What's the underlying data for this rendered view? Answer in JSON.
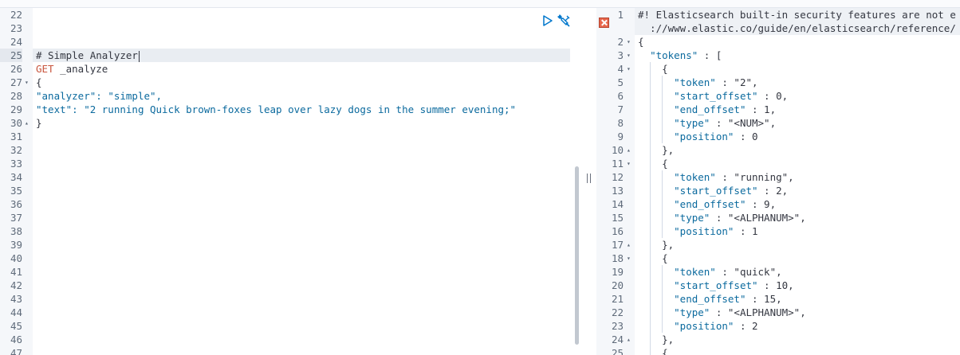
{
  "left_editor": {
    "lines": [
      {
        "n": "22",
        "fold": "",
        "text": ""
      },
      {
        "n": "23",
        "fold": "",
        "text": ""
      },
      {
        "n": "24",
        "fold": "",
        "text": ""
      },
      {
        "n": "25",
        "fold": "",
        "text": "# Simple Analyzer",
        "kind": "comment",
        "active": true
      },
      {
        "n": "26",
        "fold": "",
        "method": "GET",
        "text": " _analyze",
        "kind": "request"
      },
      {
        "n": "27",
        "fold": "▾",
        "text": "{"
      },
      {
        "n": "28",
        "fold": "",
        "key": "\"analyzer\"",
        "text": ": \"simple\","
      },
      {
        "n": "29",
        "fold": "",
        "key": "\"text\"",
        "text": ": \"2 running Quick brown-foxes leap over lazy dogs in the summer evening;\""
      },
      {
        "n": "30",
        "fold": "▴",
        "text": "}"
      },
      {
        "n": "31",
        "fold": "",
        "text": ""
      },
      {
        "n": "32",
        "fold": "",
        "text": ""
      },
      {
        "n": "33",
        "fold": "",
        "text": ""
      },
      {
        "n": "34",
        "fold": "",
        "text": ""
      },
      {
        "n": "35",
        "fold": "",
        "text": ""
      },
      {
        "n": "36",
        "fold": "",
        "text": ""
      },
      {
        "n": "37",
        "fold": "",
        "text": ""
      },
      {
        "n": "38",
        "fold": "",
        "text": ""
      },
      {
        "n": "39",
        "fold": "",
        "text": ""
      },
      {
        "n": "40",
        "fold": "",
        "text": ""
      },
      {
        "n": "41",
        "fold": "",
        "text": ""
      },
      {
        "n": "42",
        "fold": "",
        "text": ""
      },
      {
        "n": "43",
        "fold": "",
        "text": ""
      },
      {
        "n": "44",
        "fold": "",
        "text": ""
      },
      {
        "n": "45",
        "fold": "",
        "text": ""
      },
      {
        "n": "46",
        "fold": "",
        "text": ""
      },
      {
        "n": "47",
        "fold": "",
        "text": ""
      }
    ]
  },
  "right_output": {
    "lines": [
      {
        "n": "1",
        "fold": "",
        "text": "#! Elasticsearch built-in security features are not e"
      },
      {
        "n": "",
        "fold": "",
        "text": "  ://www.elastic.co/guide/en/elasticsearch/reference/"
      },
      {
        "n": "2",
        "fold": "▾",
        "text": "{"
      },
      {
        "n": "3",
        "fold": "▾",
        "text": "  \"tokens\" : ["
      },
      {
        "n": "4",
        "fold": "▾",
        "text": "    {"
      },
      {
        "n": "5",
        "fold": "",
        "text": "      \"token\" : \"2\","
      },
      {
        "n": "6",
        "fold": "",
        "text": "      \"start_offset\" : 0,"
      },
      {
        "n": "7",
        "fold": "",
        "text": "      \"end_offset\" : 1,"
      },
      {
        "n": "8",
        "fold": "",
        "text": "      \"type\" : \"<NUM>\","
      },
      {
        "n": "9",
        "fold": "",
        "text": "      \"position\" : 0"
      },
      {
        "n": "10",
        "fold": "▴",
        "text": "    },"
      },
      {
        "n": "11",
        "fold": "▾",
        "text": "    {"
      },
      {
        "n": "12",
        "fold": "",
        "text": "      \"token\" : \"running\","
      },
      {
        "n": "13",
        "fold": "",
        "text": "      \"start_offset\" : 2,"
      },
      {
        "n": "14",
        "fold": "",
        "text": "      \"end_offset\" : 9,"
      },
      {
        "n": "15",
        "fold": "",
        "text": "      \"type\" : \"<ALPHANUM>\","
      },
      {
        "n": "16",
        "fold": "",
        "text": "      \"position\" : 1"
      },
      {
        "n": "17",
        "fold": "▴",
        "text": "    },"
      },
      {
        "n": "18",
        "fold": "▾",
        "text": "    {"
      },
      {
        "n": "19",
        "fold": "",
        "text": "      \"token\" : \"quick\","
      },
      {
        "n": "20",
        "fold": "",
        "text": "      \"start_offset\" : 10,"
      },
      {
        "n": "21",
        "fold": "",
        "text": "      \"end_offset\" : 15,"
      },
      {
        "n": "22",
        "fold": "",
        "text": "      \"type\" : \"<ALPHANUM>\","
      },
      {
        "n": "23",
        "fold": "",
        "text": "      \"position\" : 2"
      },
      {
        "n": "24",
        "fold": "▴",
        "text": "    },"
      },
      {
        "n": "25",
        "fold": "",
        "text": "    {"
      }
    ]
  },
  "icons": {
    "run": "play-icon",
    "settings": "wrench-icon",
    "warning": "warning-icon"
  }
}
